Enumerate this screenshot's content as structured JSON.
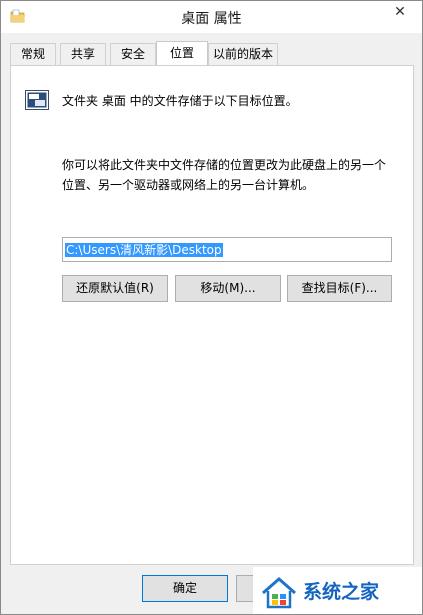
{
  "window": {
    "title": "桌面 属性",
    "close_glyph": "✕"
  },
  "tabs": [
    {
      "label": "常规"
    },
    {
      "label": "共享"
    },
    {
      "label": "安全"
    },
    {
      "label": "位置"
    },
    {
      "label": "以前的版本"
    }
  ],
  "active_tab": "位置",
  "location": {
    "description": "文件夹 桌面 中的文件存储于以下目标位置。",
    "info_line1": "你可以将此文件夹中文件存储的位置更改为此硬盘上的另一个",
    "info_line2": "位置、另一个驱动器或网络上的另一台计算机。",
    "path_value": "C:\\Users\\清风新影\\Desktop"
  },
  "buttons": {
    "restore_default": "还原默认值(R)",
    "move": "移动(M)...",
    "find_target": "查找目标(F)..."
  },
  "footer": {
    "ok": "确定",
    "cancel": ""
  },
  "watermark": {
    "text": "系统之家"
  },
  "colors": {
    "selection": "#3399ff",
    "ok_border": "#0078d7",
    "watermark_text": "#1565c0"
  }
}
